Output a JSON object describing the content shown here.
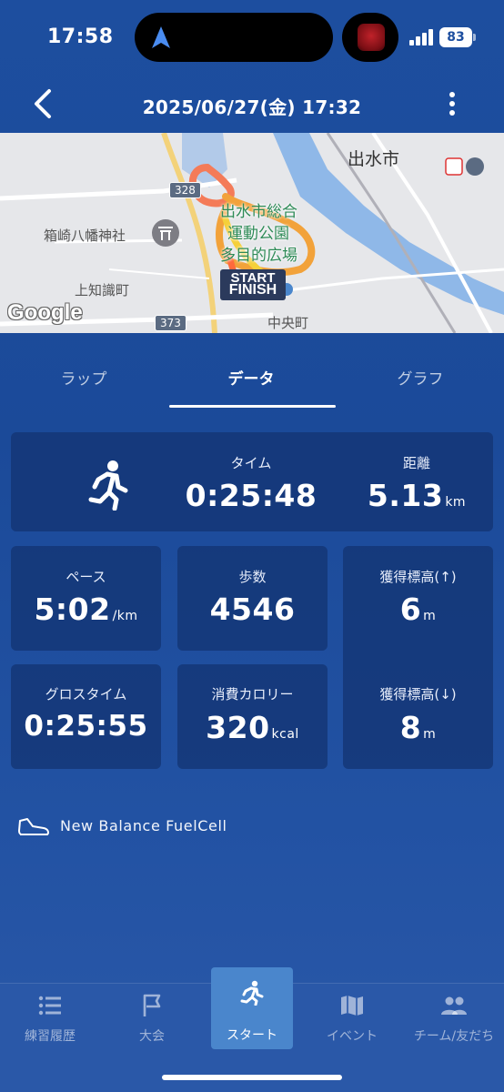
{
  "status_bar": {
    "time": "17:58",
    "battery": "83"
  },
  "header": {
    "title": "2025/06/27(金) 17:32",
    "back_icon": "chevron-left-icon",
    "more_icon": "more-vertical-icon"
  },
  "map": {
    "labels": {
      "city": "出水市",
      "shrine": "箱崎八幡神社",
      "town_west": "上知識町",
      "town_south": "中央町",
      "park_line1": "出水市総合",
      "park_line2": "運動公園",
      "park_line3": "多目的広場"
    },
    "roads": {
      "r328": "328",
      "r373": "373"
    },
    "start_label": "START",
    "finish_label": "FINISH",
    "attribution": "Google",
    "route_colors": [
      "#f2a23a",
      "#f47b58",
      "#f5d03a",
      "#ff6a3c"
    ]
  },
  "tabs": [
    {
      "label": "ラップ",
      "active": false
    },
    {
      "label": "データ",
      "active": true
    },
    {
      "label": "グラフ",
      "active": false
    }
  ],
  "stats": {
    "activity_icon": "running-icon",
    "time": {
      "label": "タイム",
      "value": "0:25:48"
    },
    "distance": {
      "label": "距離",
      "value": "5.13",
      "unit": "km"
    },
    "pace": {
      "label": "ペース",
      "value": "5:02",
      "unit": "/km"
    },
    "steps": {
      "label": "歩数",
      "value": "4546"
    },
    "elevation_gain": {
      "label": "獲得標高(↑)",
      "value": "6",
      "unit": "m"
    },
    "gross_time": {
      "label": "グロスタイム",
      "value": "0:25:55"
    },
    "calories": {
      "label": "消費カロリー",
      "value": "320",
      "unit": "kcal"
    },
    "elevation_loss": {
      "label": "獲得標高(↓)",
      "value": "8",
      "unit": "m"
    }
  },
  "shoe": {
    "icon": "shoe-icon",
    "name": "New Balance FuelCell"
  },
  "bottom_nav": [
    {
      "label": "練習履歴",
      "icon": "list-icon",
      "active": false
    },
    {
      "label": "大会",
      "icon": "flag-icon",
      "active": false
    },
    {
      "label": "スタート",
      "icon": "running-icon",
      "active": true
    },
    {
      "label": "イベント",
      "icon": "map-icon",
      "active": false
    },
    {
      "label": "チーム/友だち",
      "icon": "people-icon",
      "active": false
    }
  ],
  "colors": {
    "background": "#1d4e9f",
    "card": "#133473",
    "active_nav": "#4a86cc"
  }
}
